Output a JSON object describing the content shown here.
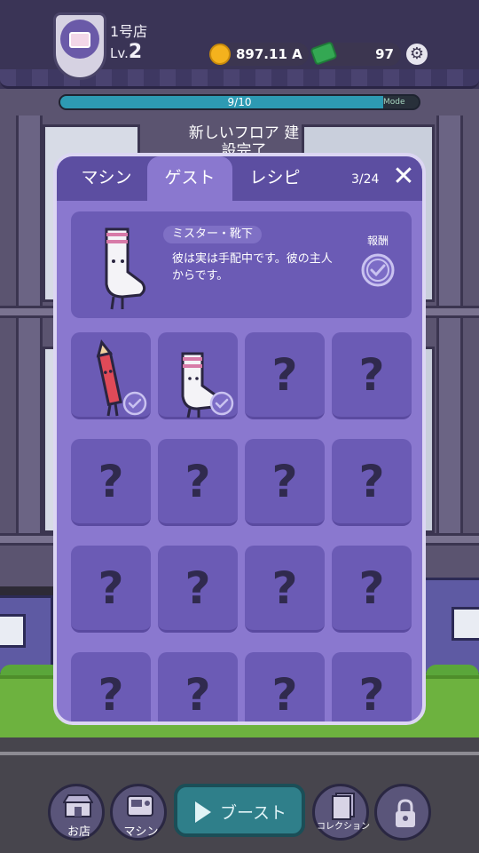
{
  "store": {
    "name": "1号店",
    "level_prefix": "Lv.",
    "level": "2"
  },
  "currency": {
    "coins": "897.11 A",
    "cash": "97"
  },
  "progress": {
    "label": "9/10",
    "value": 0.9,
    "mode_tag": "Mode"
  },
  "background_banner": "新しいフロア 建設完了",
  "modal": {
    "tabs": [
      {
        "label": "マシン",
        "active": false
      },
      {
        "label": "ゲスト",
        "active": true
      },
      {
        "label": "レシピ",
        "active": false
      }
    ],
    "page_count": "3/24",
    "close_symbol": "✕",
    "detail": {
      "name": "ミスター・靴下",
      "description": "彼は実は手配中です。彼の主人からです。",
      "reward_label": "報酬"
    },
    "grid": {
      "columns": 4,
      "cells": [
        {
          "kind": "pencil",
          "unlocked": true,
          "checked": true
        },
        {
          "kind": "sock",
          "unlocked": true,
          "checked": true
        },
        {
          "kind": "unknown",
          "unlocked": false,
          "label": "?"
        },
        {
          "kind": "unknown",
          "unlocked": false,
          "label": "?"
        },
        {
          "kind": "unknown",
          "unlocked": false,
          "label": "?"
        },
        {
          "kind": "unknown",
          "unlocked": false,
          "label": "?"
        },
        {
          "kind": "unknown",
          "unlocked": false,
          "label": "?"
        },
        {
          "kind": "unknown",
          "unlocked": false,
          "label": "?"
        },
        {
          "kind": "unknown",
          "unlocked": false,
          "label": "?"
        },
        {
          "kind": "unknown",
          "unlocked": false,
          "label": "?"
        },
        {
          "kind": "unknown",
          "unlocked": false,
          "label": "?"
        },
        {
          "kind": "unknown",
          "unlocked": false,
          "label": "?"
        },
        {
          "kind": "unknown",
          "unlocked": false,
          "label": "?"
        },
        {
          "kind": "unknown",
          "unlocked": false,
          "label": "?"
        },
        {
          "kind": "unknown",
          "unlocked": false,
          "label": "?"
        },
        {
          "kind": "unknown",
          "unlocked": false,
          "label": "?"
        }
      ]
    }
  },
  "nav": {
    "shop": "お店",
    "machine": "マシン",
    "boost": "ブースト",
    "collection": "コレクション"
  },
  "colors": {
    "modal_bg": "#8a78cf",
    "cell_bg": "#6b5bb5",
    "tab_bar": "#5c4ea1",
    "check": "#c9c2f0",
    "boost": "#2f7f8a"
  }
}
